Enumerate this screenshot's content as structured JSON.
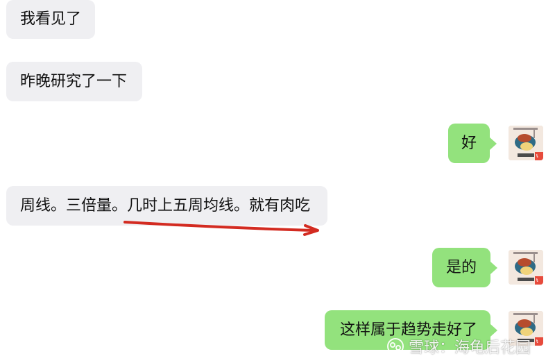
{
  "messages": [
    {
      "side": "incoming",
      "text": "我看见了"
    },
    {
      "side": "incoming",
      "text": "昨晚研究了一下"
    },
    {
      "side": "outgoing",
      "text": "好"
    },
    {
      "side": "incoming",
      "text": "周线。三倍量。几时上五周均线。就有肉吃"
    },
    {
      "side": "outgoing",
      "text": "是的"
    },
    {
      "side": "outgoing",
      "text": "这样属于趋势走好了"
    }
  ],
  "watermark": {
    "text": "雪球：海龟后花园"
  },
  "colors": {
    "incoming_bubble": "#efeff2",
    "outgoing_bubble": "#93e27d",
    "annotation_arrow": "#d32b21"
  },
  "annotation": {
    "type": "underline-arrow"
  }
}
